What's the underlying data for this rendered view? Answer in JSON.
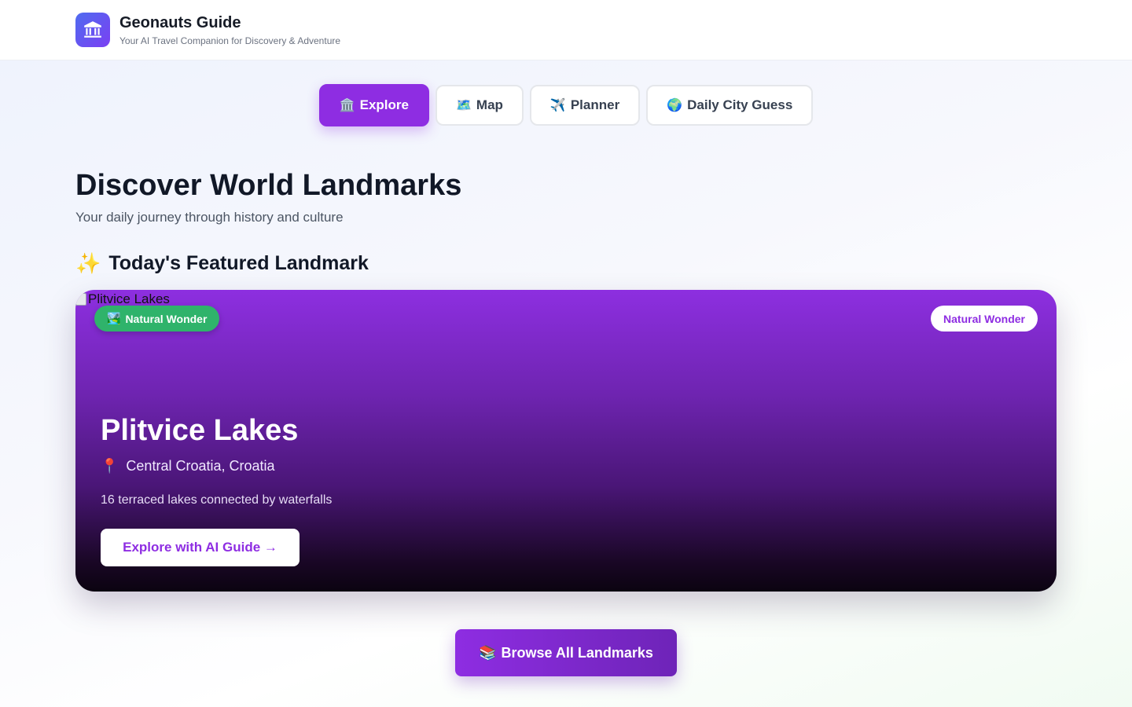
{
  "header": {
    "title": "Geonauts Guide",
    "subtitle": "Your AI Travel Companion for Discovery & Adventure",
    "logo_icon": "landmark-icon"
  },
  "tabs": [
    {
      "emoji": "🏛️",
      "label": "Explore",
      "active": true
    },
    {
      "emoji": "🗺️",
      "label": "Map",
      "active": false
    },
    {
      "emoji": "✈️",
      "label": "Planner",
      "active": false
    },
    {
      "emoji": "🌍",
      "label": "Daily City Guess",
      "active": false
    }
  ],
  "main": {
    "title": "Discover World Landmarks",
    "subtitle": "Your daily journey through history and culture",
    "section_emoji": "✨",
    "section_title": "Today's Featured Landmark"
  },
  "featured": {
    "image_alt": "Plitvice Lakes",
    "category_emoji": "🏞️",
    "category_badge": "Natural Wonder",
    "type_badge": "Natural Wonder",
    "name": "Plitvice Lakes",
    "location_emoji": "📍",
    "location": "Central Croatia, Croatia",
    "description": "16 terraced lakes connected by waterfalls",
    "cta": "Explore with AI Guide →"
  },
  "browse": {
    "emoji": "📚",
    "label": "Browse All Landmarks"
  },
  "colors": {
    "accent": "#8e2de2",
    "badge_green": "#2fb36b"
  }
}
